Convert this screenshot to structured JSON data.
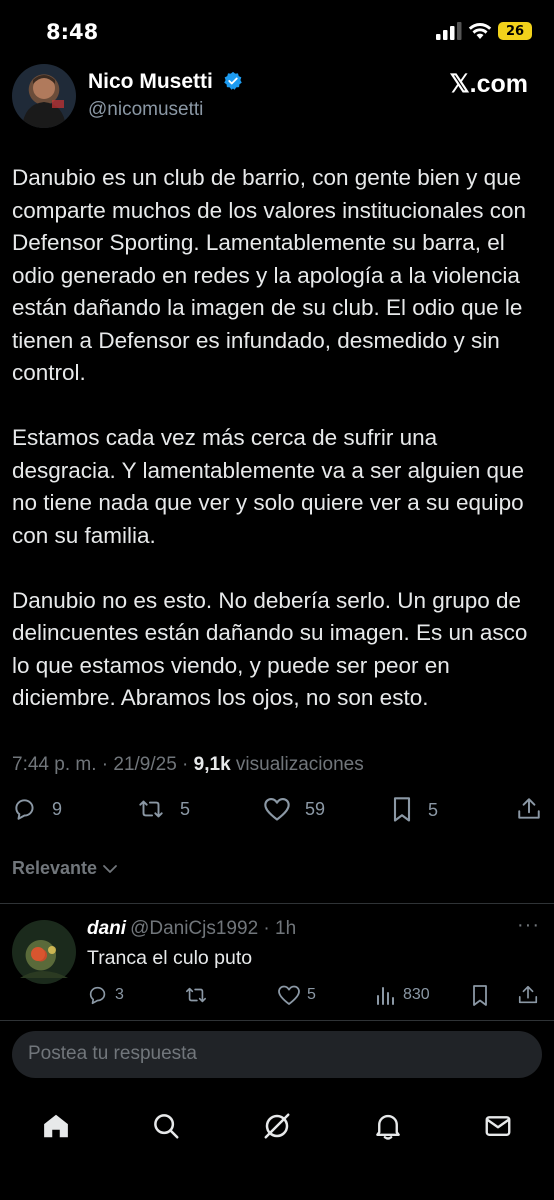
{
  "status": {
    "time": "8:48",
    "battery": "26"
  },
  "author": {
    "name": "Nico Musetti",
    "handle": "@nicomusetti"
  },
  "watermark": "𝕏.com",
  "tweet": {
    "paragraphs": [
      "Danubio es un club de barrio, con gente bien y que comparte muchos de los valores institucionales con Defensor Sporting. Lamentablemente su barra, el odio generado en redes y la apología a la violencia están dañando la imagen de su club. El odio que le tienen a Defensor es infundado, desmedido y sin control.",
      "Estamos cada vez más cerca de sufrir una desgracia. Y lamentablemente va a ser alguien que no tiene nada que ver y solo quiere ver a su equipo con su familia.",
      "Danubio no es esto. No debería serlo. Un grupo de delincuentes están dañando su imagen. Es un asco lo que estamos viendo, y puede ser peor en diciembre. Abramos los ojos, no son esto."
    ],
    "timestamp": "7:44 p. m. · 21/9/25 · ",
    "views_count": "9,1k",
    "views_label": " visualizaciones",
    "replies": "9",
    "reposts": "5",
    "likes": "59",
    "bookmarks": "5"
  },
  "sort_label": "Relevante",
  "reply": {
    "name": "dani",
    "handle": "@DaniCjs1992",
    "time": " · 1h",
    "more": "···",
    "text": "Tranca el culo puto",
    "replies": "3",
    "likes": "5",
    "views": "830"
  },
  "compose": {
    "placeholder": "Postea tu respuesta"
  },
  "colors": {
    "background": "#000000",
    "text": "#e7e9ea",
    "muted": "#71767b",
    "verified": "#1d9bf0",
    "battery": "#f2d21b"
  }
}
